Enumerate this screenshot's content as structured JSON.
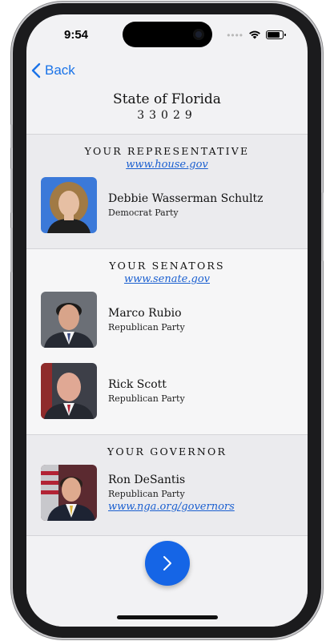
{
  "status": {
    "time": "9:54"
  },
  "nav": {
    "back_label": "Back"
  },
  "header": {
    "state": "State of Florida",
    "zip": "33029"
  },
  "representative": {
    "title": "YOUR REPRESENTATIVE",
    "link": "www.house.gov",
    "people": [
      {
        "name": "Debbie Wasserman Schultz",
        "party": "Democrat Party"
      }
    ]
  },
  "senators": {
    "title": "YOUR SENATORS",
    "link": "www.senate.gov",
    "people": [
      {
        "name": "Marco Rubio",
        "party": "Republican Party"
      },
      {
        "name": "Rick Scott",
        "party": "Republican Party"
      }
    ]
  },
  "governor": {
    "title": "YOUR GOVERNOR",
    "people": [
      {
        "name": "Ron DeSantis",
        "party": "Republican Party",
        "link": "www.nga.org/governors"
      }
    ]
  },
  "colors": {
    "accent": "#1565e6",
    "link": "#1a5fd0"
  }
}
